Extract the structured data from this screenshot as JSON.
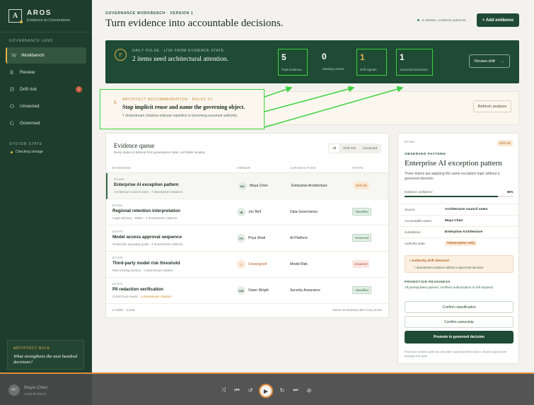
{
  "sidebar": {
    "brand": "AROS",
    "brand_sub": "Evidence-to-Cornerstone",
    "section_label": "GOVERNANCE LENS",
    "items": [
      {
        "glyph": "W",
        "label": "Workbench",
        "active": true
      },
      {
        "glyph": "R",
        "label": "Review"
      },
      {
        "glyph": "D",
        "label": "Drift risk",
        "badge": "1"
      },
      {
        "glyph": "O",
        "label": "Unowned"
      },
      {
        "glyph": "G",
        "label": "Governed"
      }
    ],
    "system_label": "SYSTEM STATE",
    "system_status": "Checking storage",
    "rule_title": "ARCHITECT RULE",
    "rule_question": "What strengthens the next hundred decisions?"
  },
  "header": {
    "eyebrow": "GOVERNANCE WORKBENCH · VERSION 1",
    "title": "Turn evidence into accountable decisions.",
    "advises": "AI advises. Architects authorize",
    "add_button": "+ Add evidence"
  },
  "pulse": {
    "icon_letter": "P",
    "eyebrow": "DAILY PULSE · LIVE FROM EVIDENCE STATE",
    "headline": "2 items need architectural attention.",
    "metrics": [
      {
        "value": "5",
        "label": "Total evidence"
      },
      {
        "value": "0",
        "label": "Awaiting review"
      },
      {
        "value": "1",
        "label": "Drift signals"
      },
      {
        "value": "1",
        "label": "Governed decisions"
      }
    ],
    "review_button": "Review drift",
    "review_arrow": "→"
  },
  "recommendation": {
    "letter": "A",
    "eyebrow": "ARCHITECT RECOMMENDATION · RULES V1",
    "title": "Stop implicit reuse and name the governing object.",
    "subtitle": "7 downstream citations indicate repetition is becoming assumed authority.",
    "refresh_button": "Refresh analysis"
  },
  "queue": {
    "title": "Evidence queue",
    "subtitle": "Every status is derived from governance state, not folder location",
    "filters": [
      "All",
      "Drift risk",
      "Unowned"
    ],
    "columns": [
      "EVIDENCE",
      "OWNER",
      "JURISDICTION",
      "STATE"
    ],
    "rows": [
      {
        "id": "EV-284",
        "title": "Enterprise AI exception pattern",
        "meta": "Architecture council notes · 7 downstream citations",
        "initials": "MC",
        "owner": "Maya Chen",
        "jurisdiction": "Enterprise Architecture",
        "state": "Drift risk",
        "kind": "drift"
      },
      {
        "id": "EV-281",
        "title": "Regional retention interpretation",
        "meta": "Legal advisory · EMEA · 3 downstream citations",
        "initials": "JB",
        "owner": "Jon Bell",
        "jurisdiction": "Data Governance",
        "state": "Classified",
        "kind": "ok"
      },
      {
        "id": "EV-279",
        "title": "Model access approval sequence",
        "meta": "Production operating guide · 4 downstream citations",
        "initials": "PS",
        "owner": "Priya Shah",
        "jurisdiction": "AI Platform",
        "state": "Governed",
        "kind": "ok"
      },
      {
        "id": "EV-276",
        "title": "Third-party model risk threshold",
        "meta": "Risk working session · 1 downstream citation",
        "initials": "?",
        "owner": "Unassigned",
        "jurisdiction": "Model Risk",
        "state": "Unowned",
        "kind": "un"
      },
      {
        "id": "EV-272",
        "title": "PII redaction verification",
        "meta_prefix": "Control test results · ",
        "meta_amber": "2 downstream citations",
        "initials": "OW",
        "owner": "Owen Wright",
        "jurisdiction": "Security Assurance",
        "state": "Classified",
        "kind": "ok"
      }
    ],
    "footer_left": "5 visible · 5 total",
    "footer_right": "Status recalculates after every action"
  },
  "detail": {
    "id": "EV-284",
    "badge": "Drift risk",
    "eyebrow": "OBSERVED PATTERN",
    "title": "Enterprise AI exception pattern",
    "description": "Three teams are applying the same exception logic without a governed decision.",
    "confidence_label": "Evidence confidence",
    "confidence_value": "86%",
    "confidence": 0.86,
    "fields": [
      {
        "k": "Source",
        "v": "Architecture council notes"
      },
      {
        "k": "Accountable owner",
        "v": "Maya Chen"
      },
      {
        "k": "Jurisdiction",
        "v": "Enterprise Architecture"
      },
      {
        "k": "Authority state",
        "v": "Observation only",
        "tag": true
      }
    ],
    "drift_title": "Authority drift detected",
    "drift_sub": "7 downstream citations without a governed decision.",
    "promo_label": "PROMOTION READINESS",
    "promo_sub": "All prerequisites passed. Architect authorization is still required.",
    "confirm_class": "Confirm classification",
    "confirm_owner": "Confirm ownership",
    "promote": "Promote to governed decision",
    "footnote": "Promotion creates authority only after explicit architect action. Model output never changes this state."
  },
  "player": {
    "initials": "MC",
    "name": "Maya Chen",
    "role": "Lead Architect"
  },
  "colors": {
    "primary": "#1f4a33",
    "accent": "#e3b34a",
    "drift": "#b55e23",
    "highlight": "#39d23d",
    "progress": "#e08b3b"
  }
}
